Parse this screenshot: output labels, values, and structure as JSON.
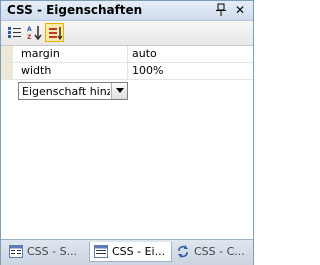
{
  "window": {
    "title": "CSS - Eigenschaften",
    "pin_icon": "pin-icon",
    "close_icon": "close-icon",
    "close_label": "✕"
  },
  "toolbar": {
    "buttons": [
      {
        "name": "categorized-view",
        "icon": "categorized-list-icon",
        "active": false
      },
      {
        "name": "alphabetical-sort",
        "icon": "sort-alphabetical-icon",
        "active": false
      },
      {
        "name": "applied-properties",
        "icon": "applied-properties-icon",
        "active": true
      }
    ]
  },
  "properties": [
    {
      "name": "margin",
      "value": "auto"
    },
    {
      "name": "width",
      "value": "100%"
    }
  ],
  "add_property": {
    "selected": "Eigenschaft hinzufügen"
  },
  "tabs": [
    {
      "label": "CSS - S...",
      "icon": "css-styles-icon",
      "active": false
    },
    {
      "label": "CSS - Ei...",
      "icon": "css-properties-icon",
      "active": true
    },
    {
      "label": "CSS - C...",
      "icon": "css-refresh-icon",
      "active": false
    }
  ],
  "colors": {
    "accent_border": "#7f9db9",
    "active_button": "#ffe9a8"
  }
}
